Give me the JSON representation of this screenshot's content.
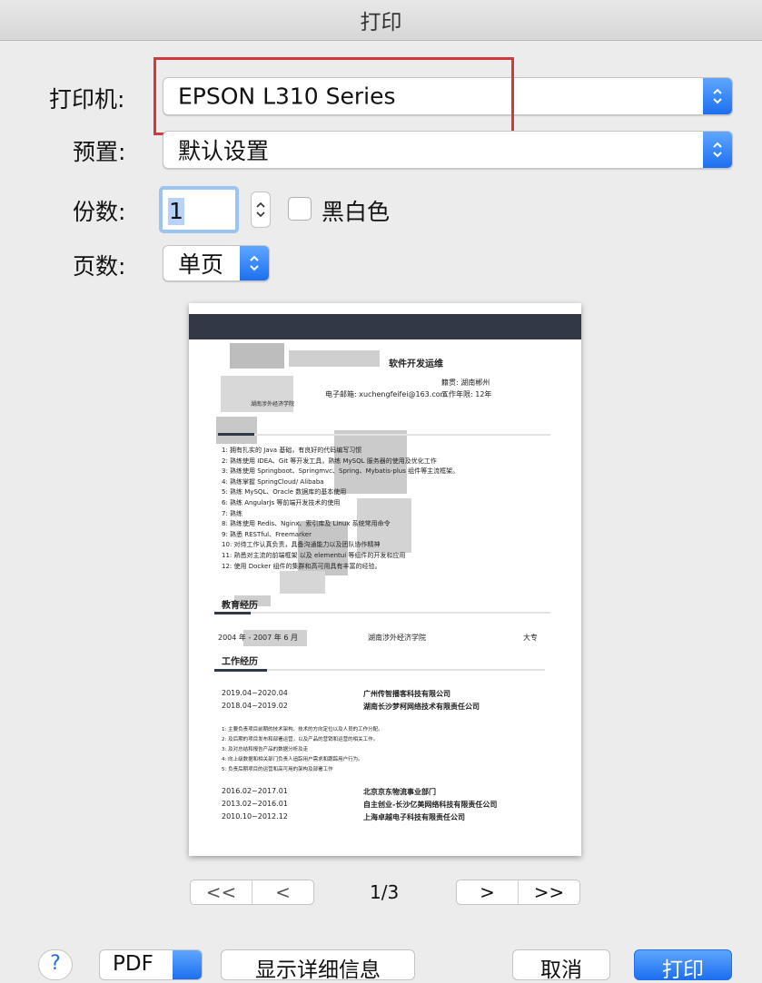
{
  "window": {
    "title": "打印"
  },
  "printer": {
    "label": "打印机:",
    "value": "EPSON L310 Series"
  },
  "presets": {
    "label": "预置:",
    "value": "默认设置"
  },
  "copies": {
    "label": "份数:",
    "value": "1",
    "bw_label": "黑白色",
    "bw_checked": false
  },
  "pages": {
    "label": "页数:",
    "value": "单页"
  },
  "preview": {
    "name_line": "软件开发运维",
    "phone": "电子邮箱: xuchengfeifei@163.com",
    "age": "工作年限: 12年",
    "native": "籍贯: 湖南郴州",
    "school_line": "湖南涉外经济学院",
    "skills": [
      "1: 拥有扎实的 Java 基础，有良好的代码编写习惯",
      "2: 熟练使用 IDEA、Git 等开发工具，熟练 MySQL 服务器的使用及优化工作",
      "3: 熟练使用 Springboot、Springmvc、Spring、Mybatis-plus 组件等主流框架。",
      "4: 熟练掌握 SpringCloud/ Alibaba",
      "5: 熟练 MySQL、Oracle 数据库的基本使用",
      "6: 熟练 AngularJs 等前端开发技术的使用",
      "7: 熟练",
      "8: 熟练使用 Redis、Nginx、索引库及 Linux 系统常用命令",
      "9: 熟悉 RESTful、Freemarker",
      "10: 对待工作认真负责，具备沟通能力以及团队协作精神",
      "11: 熟悉对主流的前端框架 以及 elementui 等组件的开发和应用",
      "12: 使用 Docker 组件的集群和高可用具有丰富的经验。"
    ],
    "edu_title": "教育经历",
    "edu_period": "2004 年 - 2007 年 6 月",
    "edu_school": "湖南涉外经济学院",
    "edu_degree": "大专",
    "work_title": "工作经历",
    "jobs_a": [
      {
        "period": "2019.04~2020.04",
        "company": "广州传智播客科技有限公司"
      },
      {
        "period": "2018.04~2019.02",
        "company": "湖南长沙梦柯网络技术有限责任公司"
      }
    ],
    "duties": [
      "1: 主要负责项目前期的技术架构、技术的方向定位以及人员的工作分配。",
      "2: 及后期的项目发布和部署运营，以及产品的营销和运营的相关工作。",
      "3: 及对总结和报告产品的数据分析及走",
      "4: 向上级数据和相关部门负责人追踪用户需求和跟踪用户行为。",
      "5: 负责后期项目的运营和高可用的架构及部署工作"
    ],
    "jobs_b": [
      {
        "period": "2016.02~2017.01",
        "company": "北京京东物流事业部门"
      },
      {
        "period": "2013.02~2016.01",
        "company": "自主创业-长沙亿美网络科技有限责任公司"
      },
      {
        "period": "2010.10~2012.12",
        "company": "上海卓越电子科技有限责任公司"
      }
    ]
  },
  "pager": {
    "first": "<<",
    "prev": "<",
    "indicator": "1/3",
    "next": ">",
    "last": ">>"
  },
  "bottom": {
    "help": "?",
    "pdf": "PDF",
    "details": "显示详细信息",
    "cancel": "取消",
    "print": "打印"
  },
  "colors": {
    "accent": "#1d6ff0",
    "highlight_box": "#d23a3a",
    "preview_band": "#313846"
  }
}
